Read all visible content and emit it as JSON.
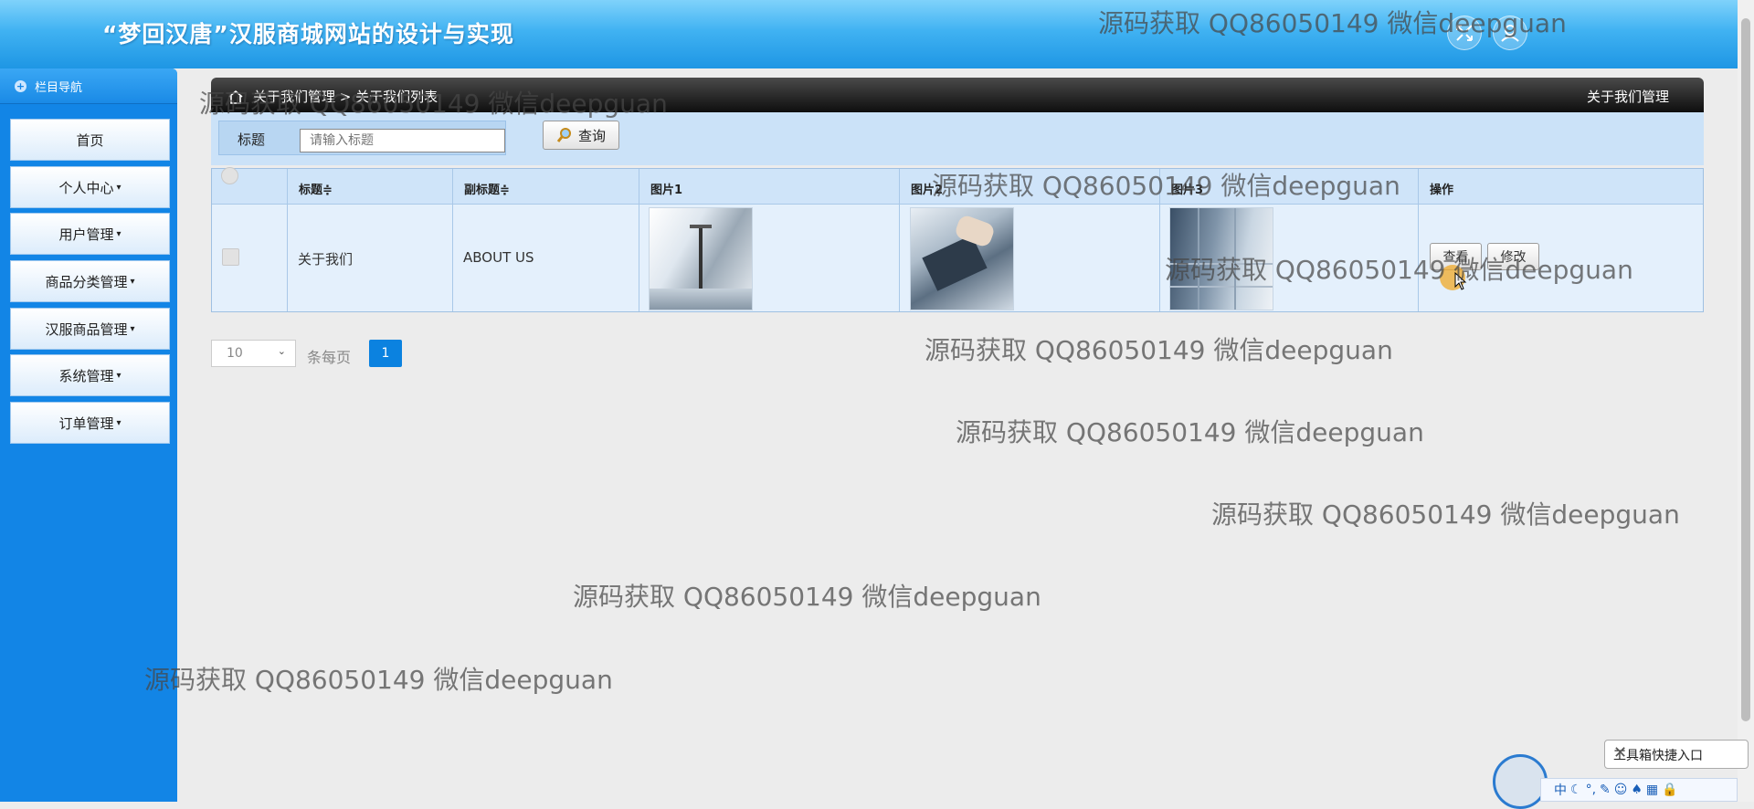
{
  "header": {
    "title": "“梦回汉唐”汉服商城网站的设计与实现"
  },
  "sidebar": {
    "nav_title": "栏目导航",
    "items": [
      {
        "label": "首页",
        "caret": ""
      },
      {
        "label": "个人中心",
        "caret": "▾"
      },
      {
        "label": "用户管理",
        "caret": "▾"
      },
      {
        "label": "商品分类管理",
        "caret": "▾"
      },
      {
        "label": "汉服商品管理",
        "caret": "▾"
      },
      {
        "label": "系统管理",
        "caret": "▾"
      },
      {
        "label": "订单管理",
        "caret": "▾"
      }
    ]
  },
  "main": {
    "breadcrumb": "关于我们管理 > 关于我们列表",
    "section_title": "关于我们管理"
  },
  "search": {
    "label": "标题",
    "placeholder": "请输入标题",
    "button": "查询"
  },
  "table": {
    "columns": [
      "标题≑",
      "副标题≑",
      "图片1",
      "图片2",
      "图片3",
      "操作"
    ],
    "rows": [
      {
        "title": "关于我们",
        "subtitle": "ABOUT US",
        "view": "查看",
        "edit": "修改"
      }
    ]
  },
  "pagination": {
    "per_page": "10",
    "per_page_label": "条每页",
    "current": "1"
  },
  "watermark": "源码获取 QQ86050149 微信deepguan",
  "toolbox": {
    "label": "工具箱快捷入口",
    "close": "✕"
  },
  "ime": {
    "mode": "中"
  }
}
